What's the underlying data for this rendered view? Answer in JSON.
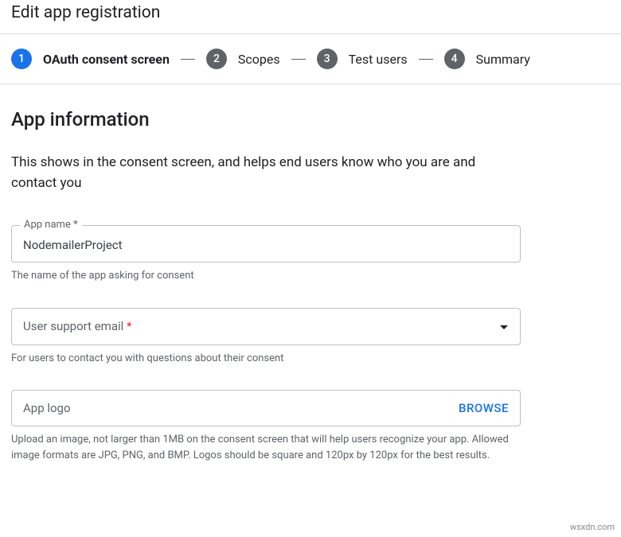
{
  "page_title": "Edit app registration",
  "stepper": {
    "steps": [
      {
        "num": "1",
        "label": "OAuth consent screen",
        "active": true
      },
      {
        "num": "2",
        "label": "Scopes",
        "active": false
      },
      {
        "num": "3",
        "label": "Test users",
        "active": false
      },
      {
        "num": "4",
        "label": "Summary",
        "active": false
      }
    ]
  },
  "section": {
    "title": "App information",
    "desc": "This shows in the consent screen, and helps end users know who you are and contact you"
  },
  "app_name": {
    "label": "App name *",
    "value": "NodemailerProject",
    "helper": "The name of the app asking for consent"
  },
  "support_email": {
    "placeholder": "User support email",
    "required_mark": "*",
    "helper": "For users to contact you with questions about their consent"
  },
  "app_logo": {
    "placeholder": "App logo",
    "browse": "BROWSE",
    "helper": "Upload an image, not larger than 1MB on the consent screen that will help users recognize your app. Allowed image formats are JPG, PNG, and BMP. Logos should be square and 120px by 120px for the best results."
  },
  "watermark": "wsxdn.com"
}
